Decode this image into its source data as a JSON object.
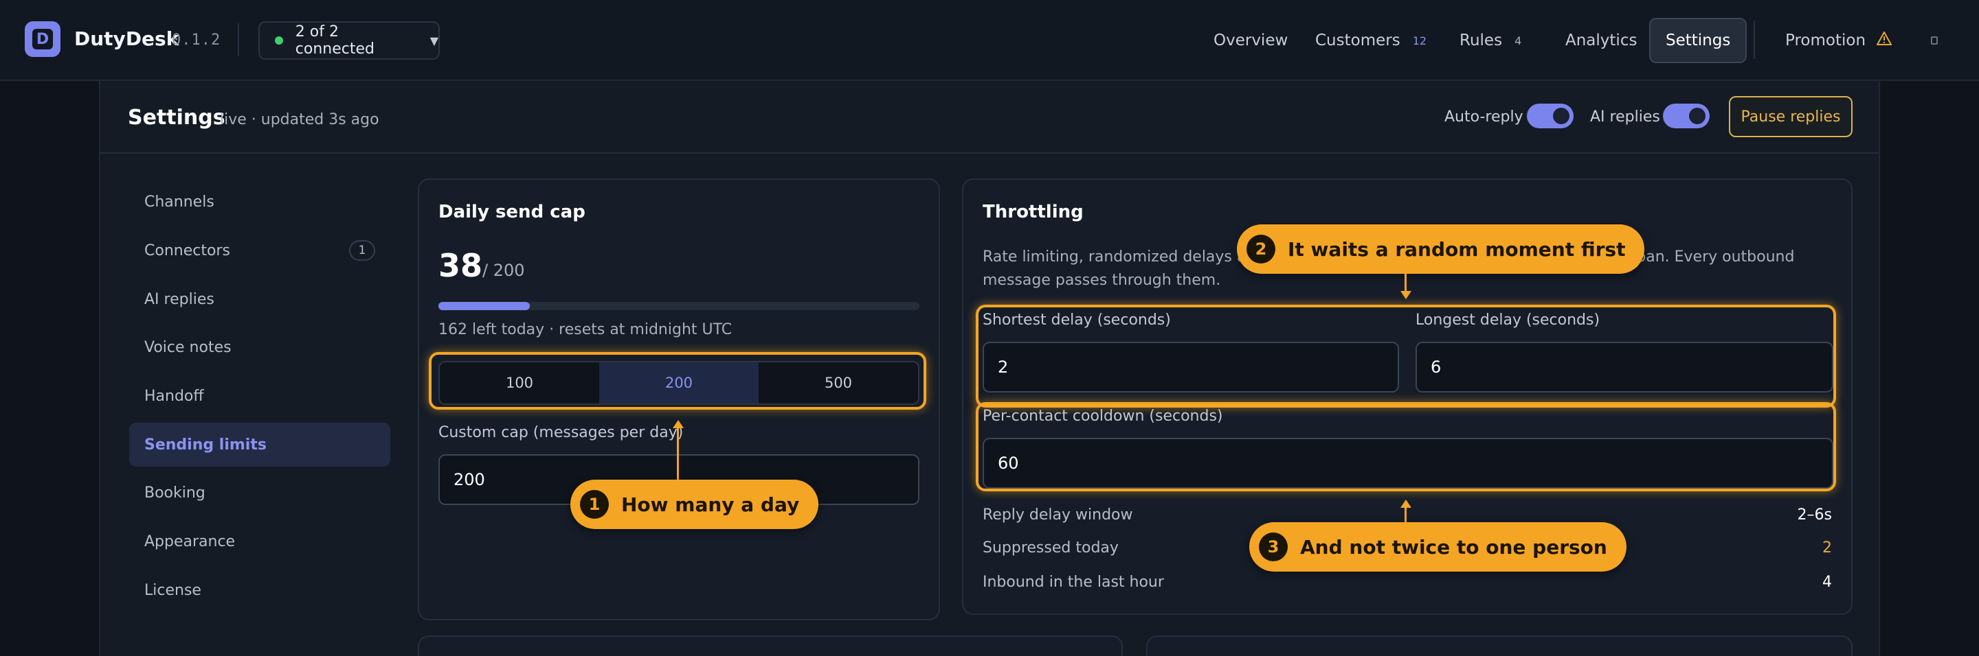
{
  "app": {
    "logo_letter": "D",
    "name": "DutyDesk",
    "version": "0.1.2"
  },
  "connection": {
    "status_label": "2 of 2 connected",
    "status_color": "#3ecf6e"
  },
  "nav": [
    {
      "label": "Overview",
      "count": ""
    },
    {
      "label": "Customers",
      "count": "12"
    },
    {
      "label": "Rules",
      "count": "4"
    },
    {
      "label": "Analytics",
      "count": ""
    },
    {
      "label": "Settings",
      "count": "",
      "active": true
    },
    {
      "label": "Promotion",
      "count": "",
      "icon": "warning-icon"
    }
  ],
  "page": {
    "title": "Settings",
    "status": "live · updated 3s ago",
    "auto_reply_label": "Auto-reply",
    "auto_reply_on": true,
    "ai_replies_label": "AI replies",
    "ai_replies_on": true,
    "pause_label": "Pause replies"
  },
  "sidebar": {
    "items": [
      {
        "label": "Channels"
      },
      {
        "label": "Connectors",
        "badge": "1"
      },
      {
        "label": "AI replies"
      },
      {
        "label": "Voice notes"
      },
      {
        "label": "Handoff"
      },
      {
        "label": "Sending limits",
        "active": true
      },
      {
        "label": "Booking"
      },
      {
        "label": "Appearance"
      },
      {
        "label": "License"
      }
    ]
  },
  "daily_cap": {
    "title": "Daily send cap",
    "used": "38",
    "limit_text": "/ 200",
    "progress_fraction": 0.19,
    "remaining_text": "162 left today · resets at midnight UTC",
    "presets": [
      {
        "label": "100"
      },
      {
        "label": "200",
        "active": true
      },
      {
        "label": "500"
      }
    ],
    "custom_label": "Custom cap (messages per day)",
    "custom_value": "200"
  },
  "throttling": {
    "title": "Throttling",
    "description": "Rate limiting, randomized delays and ",
    "description_tail": "ount ban. Every outbound message passes through them.",
    "min_delay_label": "Shortest delay (seconds)",
    "min_delay_value": "2",
    "max_delay_label": "Longest delay (seconds)",
    "max_delay_value": "6",
    "cooldown_label": "Per-contact cooldown (seconds)",
    "cooldown_value": "60",
    "stats": [
      {
        "label": "Reply delay window",
        "value": "2–6s",
        "color": "#ffffff"
      },
      {
        "label": "Suppressed today",
        "value": "2",
        "color": "#e8a93a"
      },
      {
        "label": "Inbound in the last hour",
        "value": "4",
        "color": "#ffffff"
      }
    ]
  },
  "annotations": [
    {
      "number": "1",
      "text": "How many a day"
    },
    {
      "number": "2",
      "text": "It waits a random moment first"
    },
    {
      "number": "3",
      "text": "And not twice to one person"
    }
  ],
  "colors": {
    "accent": "#7b84ec",
    "annotation": "#f5a524",
    "warning": "#e8a93a"
  }
}
